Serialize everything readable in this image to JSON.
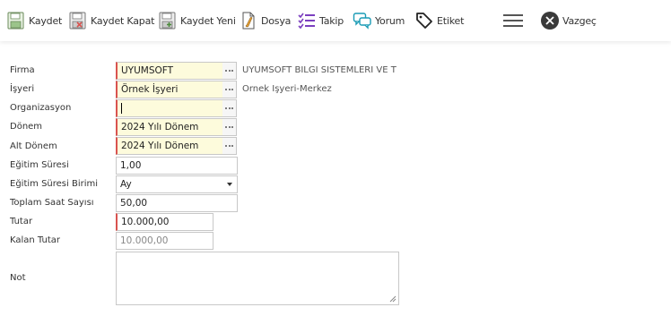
{
  "toolbar": {
    "save": "Kaydet",
    "save_close": "Kaydet Kapat",
    "save_new": "Kaydet Yeni",
    "file": "Dosya",
    "follow": "Takip",
    "comment": "Yorum",
    "tag": "Etiket",
    "cancel": "Vazgeç"
  },
  "form": {
    "firma": {
      "label": "Firma",
      "value": "UYUMSOFT",
      "desc": "UYUMSOFT BİLGİ SİSTEMLERİ VE T"
    },
    "isyeri": {
      "label": "İşyeri",
      "value": "Örnek İşyeri",
      "desc": "Örnek İşyeri-Merkez"
    },
    "organizasyon": {
      "label": "Organizasyon",
      "value": ""
    },
    "donem": {
      "label": "Dönem",
      "value": "2024 Yılı Dönem"
    },
    "alt_donem": {
      "label": "Alt Dönem",
      "value": "2024 Yılı Dönem"
    },
    "egitim_suresi": {
      "label": "Eğitim Süresi",
      "value": "1,00"
    },
    "egitim_suresi_birimi": {
      "label": "Eğitim Süresi Birimi",
      "value": "Ay"
    },
    "toplam_saat": {
      "label": "Toplam Saat Sayısı",
      "value": "50,00"
    },
    "tutar": {
      "label": "Tutar",
      "value": "10.000,00"
    },
    "kalan_tutar": {
      "label": "Kalan Tutar",
      "value": "10.000,00"
    },
    "not": {
      "label": "Not",
      "value": ""
    }
  },
  "colors": {
    "required_bg": "#fdfbdc",
    "required_border": "#d9534f",
    "accent_purple": "#7b3fbf",
    "accent_teal": "#1a9bb5"
  }
}
